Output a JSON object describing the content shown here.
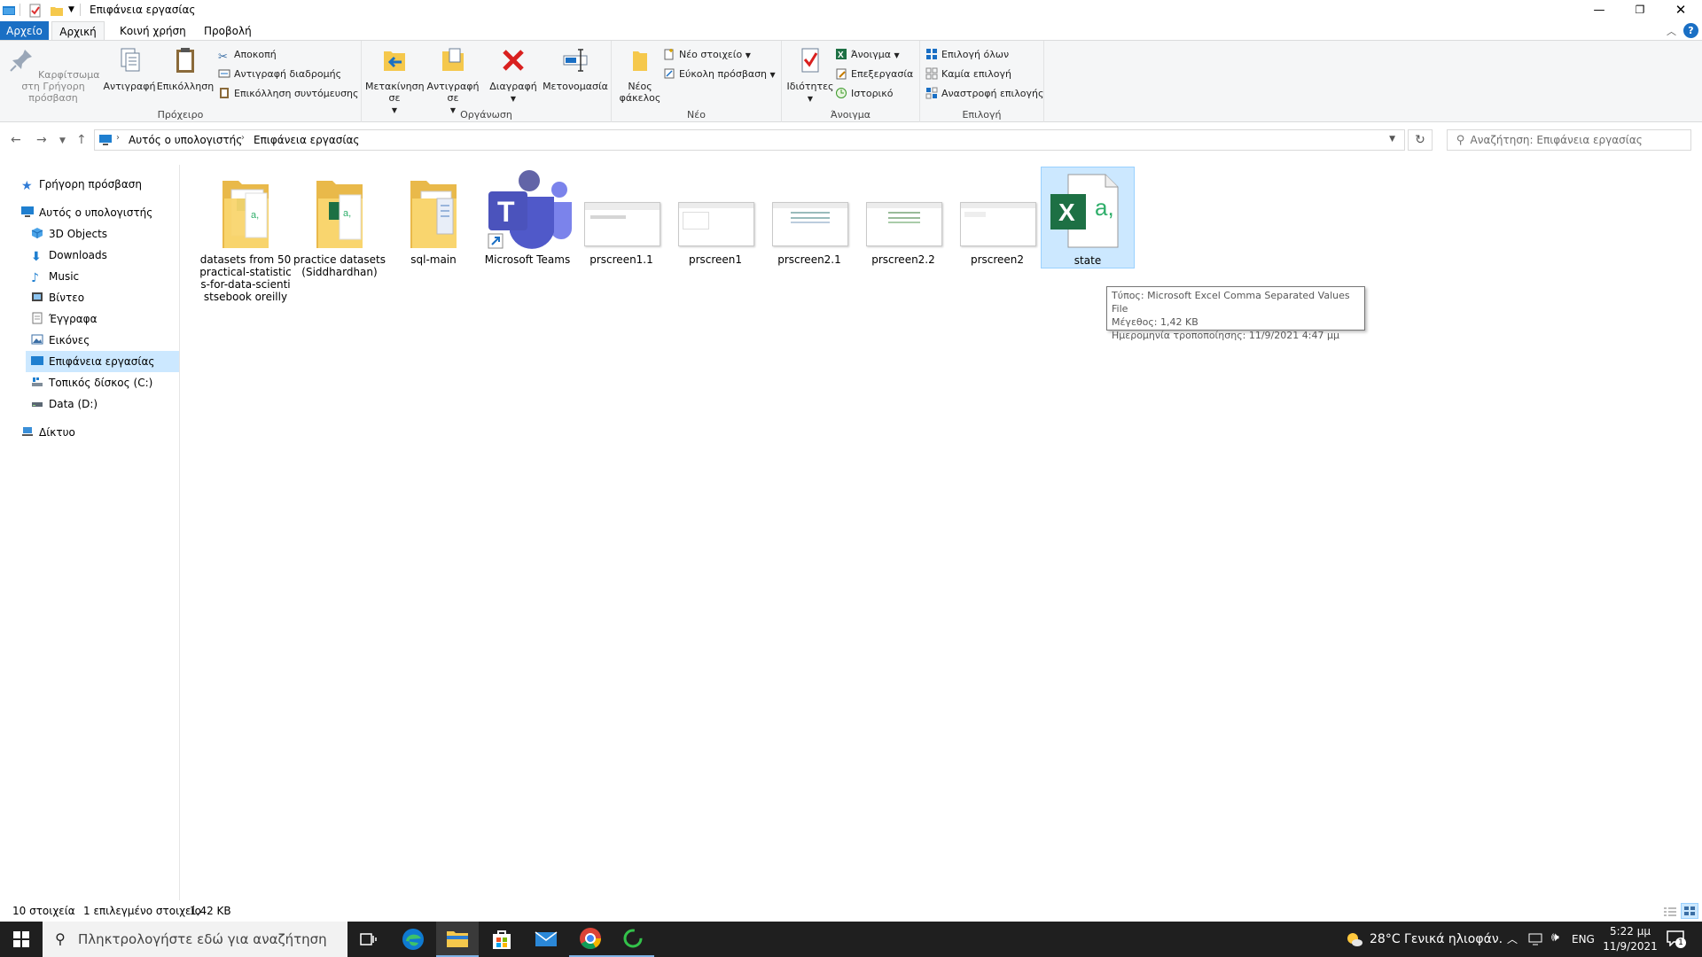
{
  "window": {
    "title": "Επιφάνεια εργασίας"
  },
  "menu_tabs": [
    "Αρχείο",
    "Αρχική",
    "Κοινή χρήση",
    "Προβολή"
  ],
  "ribbon": {
    "clipboard": {
      "pin": "Καρφίτσωμα στη Γρήγορη πρόσβαση",
      "copy": "Αντιγραφή",
      "paste": "Επικόλληση",
      "cut": "Αποκοπή",
      "copy_path": "Αντιγραφή διαδρομής",
      "paste_shortcut": "Επικόλληση συντόμευσης",
      "group": "Πρόχειρο"
    },
    "organize": {
      "move": "Μετακίνηση σε",
      "copy_to": "Αντιγραφή σε",
      "delete": "Διαγραφή",
      "rename": "Μετονομασία",
      "group": "Οργάνωση"
    },
    "new": {
      "new_folder": "Νέος φάκελος",
      "new_item": "Νέο στοιχείο",
      "easy_access": "Εύκολη πρόσβαση",
      "group": "Νέο"
    },
    "open": {
      "properties": "Ιδιότητες",
      "open": "Άνοιγμα",
      "edit": "Επεξεργασία",
      "history": "Ιστορικό",
      "group": "Άνοιγμα"
    },
    "select": {
      "select_all": "Επιλογή όλων",
      "select_none": "Καμία επιλογή",
      "invert": "Αναστροφή επιλογής",
      "group": "Επιλογή"
    }
  },
  "address": {
    "crumbs": [
      "Αυτός ο υπολογιστής",
      "Επιφάνεια εργασίας"
    ],
    "search_placeholder": "Αναζήτηση: Επιφάνεια εργασίας"
  },
  "nav": {
    "quick_access": "Γρήγορη πρόσβαση",
    "this_pc": "Αυτός ο υπολογιστής",
    "items": [
      "3D Objects",
      "Downloads",
      "Music",
      "Βίντεο",
      "Έγγραφα",
      "Εικόνες",
      "Επιφάνεια εργασίας",
      "Τοπικός δίσκος (C:)",
      "Data (D:)"
    ],
    "network": "Δίκτυο"
  },
  "files": [
    {
      "name": "datasets from 50 practical-statistic s-for-data-scienti stsebook oreilly",
      "kind": "folder-xls"
    },
    {
      "name": "practice datasets (Siddhardhan)",
      "kind": "folder-xls"
    },
    {
      "name": "sql-main",
      "kind": "folder"
    },
    {
      "name": "Microsoft Teams",
      "kind": "teams"
    },
    {
      "name": "prscreen1.1",
      "kind": "image"
    },
    {
      "name": "prscreen1",
      "kind": "image"
    },
    {
      "name": "prscreen2.1",
      "kind": "image"
    },
    {
      "name": "prscreen2.2",
      "kind": "image"
    },
    {
      "name": "prscreen2",
      "kind": "image"
    },
    {
      "name": "state",
      "kind": "csv"
    }
  ],
  "tooltip": {
    "type": "Τύπος: Microsoft Excel Comma Separated Values File",
    "size": "Μέγεθος: 1,42 KB",
    "modified": "Ημερομηνία τροποποίησης: 11/9/2021 4:47 μμ"
  },
  "status": {
    "count": "10 στοιχεία",
    "selected": "1 επιλεγμένο στοιχείο",
    "size": "1,42 KB"
  },
  "taskbar": {
    "search_placeholder": "Πληκτρολογήστε εδώ για αναζήτηση",
    "weather": "28°C  Γενικά ηλιοφάν.",
    "lang": "ENG",
    "time": "5:22 μμ",
    "date": "11/9/2021",
    "notif_count": "1"
  }
}
